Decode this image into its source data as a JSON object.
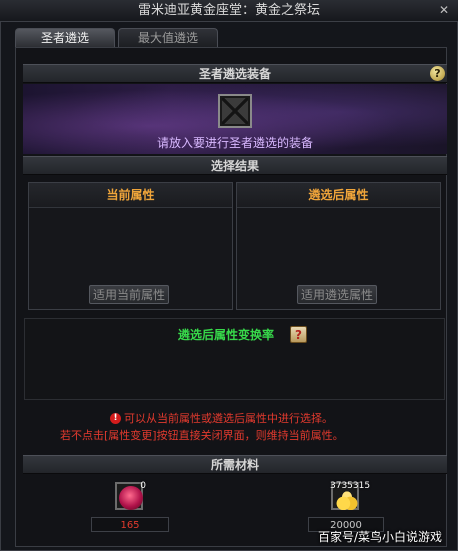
{
  "window": {
    "title": "雷米迪亚黄金座堂：黄金之祭坛",
    "close_glyph": "✕"
  },
  "tabs": [
    {
      "label": "圣者遴选",
      "active": true
    },
    {
      "label": "最大值遴选",
      "active": false
    }
  ],
  "equip_section": {
    "header": "圣者遴选装备",
    "help_glyph": "?",
    "prompt": "请放入要进行圣者遴选的装备"
  },
  "result_section": {
    "header": "选择结果",
    "current": {
      "title": "当前属性",
      "button": "适用当前属性"
    },
    "new": {
      "title": "遴选后属性",
      "button": "适用遴选属性"
    }
  },
  "rate": {
    "label": "遴选后属性变换率",
    "icon": "scroll-icon"
  },
  "notes": {
    "warn_glyph": "!",
    "line1": "可以从当前属性或遴选后属性中进行选择。",
    "line2": "若不点击[属性变更]按钮直接关闭界面，则维持当前属性。"
  },
  "materials": {
    "header": "所需材料",
    "items": [
      {
        "icon": "pink-orb-icon",
        "count": "0",
        "required": "165"
      },
      {
        "icon": "gold-coins-icon",
        "count": "3735315",
        "required": "20000"
      }
    ]
  },
  "watermark": "百家号/菜鸟小白说游戏",
  "colors": {
    "accent_orange": "#f0a53a",
    "rate_green": "#37d84a",
    "warning_red": "#e23a2e",
    "prompt_purple": "#d8b8ff"
  }
}
